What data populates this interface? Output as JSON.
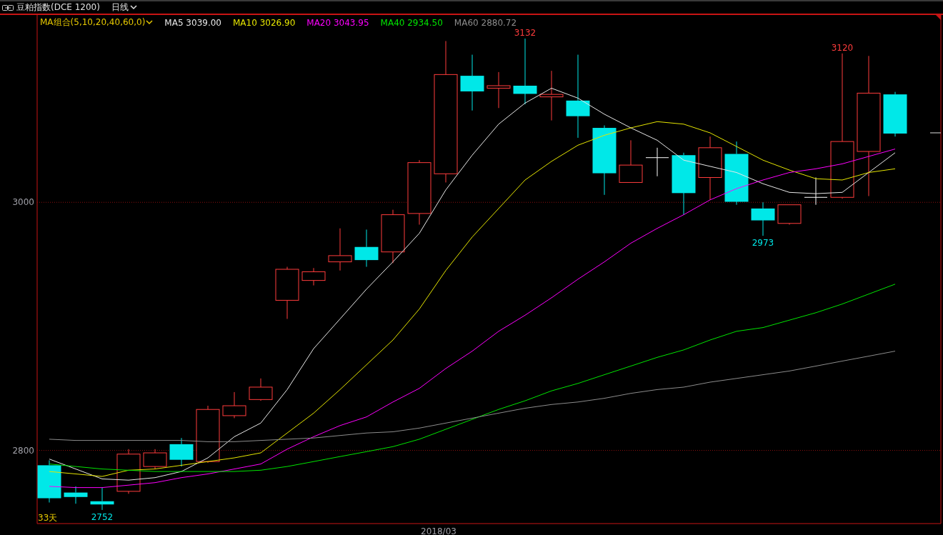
{
  "toolbar": {
    "title": "豆粕指数(DCE 1200)",
    "period": "日线"
  },
  "legend": {
    "group": "MA组合(5,10,20,40,60,0)",
    "values": [
      "3039.00",
      "3026.90",
      "3043.95",
      "2934.50",
      "2880.72"
    ]
  },
  "chart": {
    "count_label": "33天",
    "date_label": "2018/03",
    "price_labels": [
      {
        "kind": "high",
        "text": "3132"
      },
      {
        "kind": "high",
        "text": "3120"
      },
      {
        "kind": "low",
        "text": "2973"
      },
      {
        "kind": "low",
        "text": "2752"
      }
    ],
    "chart_data": {
      "type": "line",
      "ylim": [
        2741,
        3151
      ],
      "yticks": [
        2800,
        3000
      ],
      "series": [
        {
          "name": "MA5",
          "color": "#e8e8e8",
          "values": [
            2793,
            2785,
            2777,
            2776,
            2778,
            2783,
            2794,
            2811,
            2822,
            2849,
            2882,
            2906,
            2930,
            2952,
            2975,
            3010,
            3038,
            3063,
            3080,
            3092,
            3084,
            3071,
            3060,
            3050,
            3034,
            3029,
            3024,
            3015,
            3008,
            3007,
            3008,
            3024,
            3040
          ]
        },
        {
          "name": "MA10",
          "color": "#e6e600",
          "values": [
            2783,
            2781,
            2779,
            2784,
            2785,
            2788,
            2791,
            2794,
            2798,
            2814,
            2830,
            2849,
            2869,
            2889,
            2914,
            2945,
            2972,
            2995,
            3018,
            3033,
            3046,
            3054,
            3060,
            3065,
            3063,
            3056,
            3045,
            3034,
            3026,
            3019,
            3018,
            3024,
            3027
          ]
        },
        {
          "name": "MA20",
          "color": "#ff00ff",
          "values": [
            2771,
            2770,
            2770,
            2772,
            2774,
            2778,
            2781,
            2785,
            2789,
            2801,
            2811,
            2820,
            2827,
            2839,
            2850,
            2866,
            2880,
            2896,
            2909,
            2923,
            2938,
            2952,
            2967,
            2979,
            2990,
            3002,
            3011,
            3018,
            3024,
            3027,
            3031,
            3037,
            3043
          ]
        },
        {
          "name": "MA40",
          "color": "#00e600",
          "values": [
            2789,
            2787,
            2785,
            2784,
            2783,
            2783,
            2783,
            2783,
            2784,
            2787,
            2791,
            2795,
            2799,
            2803,
            2809,
            2817,
            2825,
            2833,
            2840,
            2848,
            2854,
            2861,
            2868,
            2875,
            2881,
            2889,
            2896,
            2899,
            2905,
            2911,
            2918,
            2926,
            2934
          ]
        },
        {
          "name": "MA60",
          "color": "#8c8c8c",
          "values": [
            2809,
            2808,
            2808,
            2808,
            2808,
            2808,
            2807,
            2807,
            2808,
            2809,
            2810,
            2812,
            2814,
            2815,
            2818,
            2822,
            2826,
            2830,
            2834,
            2837,
            2839,
            2842,
            2846,
            2849,
            2851,
            2855,
            2858,
            2861,
            2864,
            2868,
            2872,
            2876,
            2880
          ]
        }
      ]
    }
  }
}
